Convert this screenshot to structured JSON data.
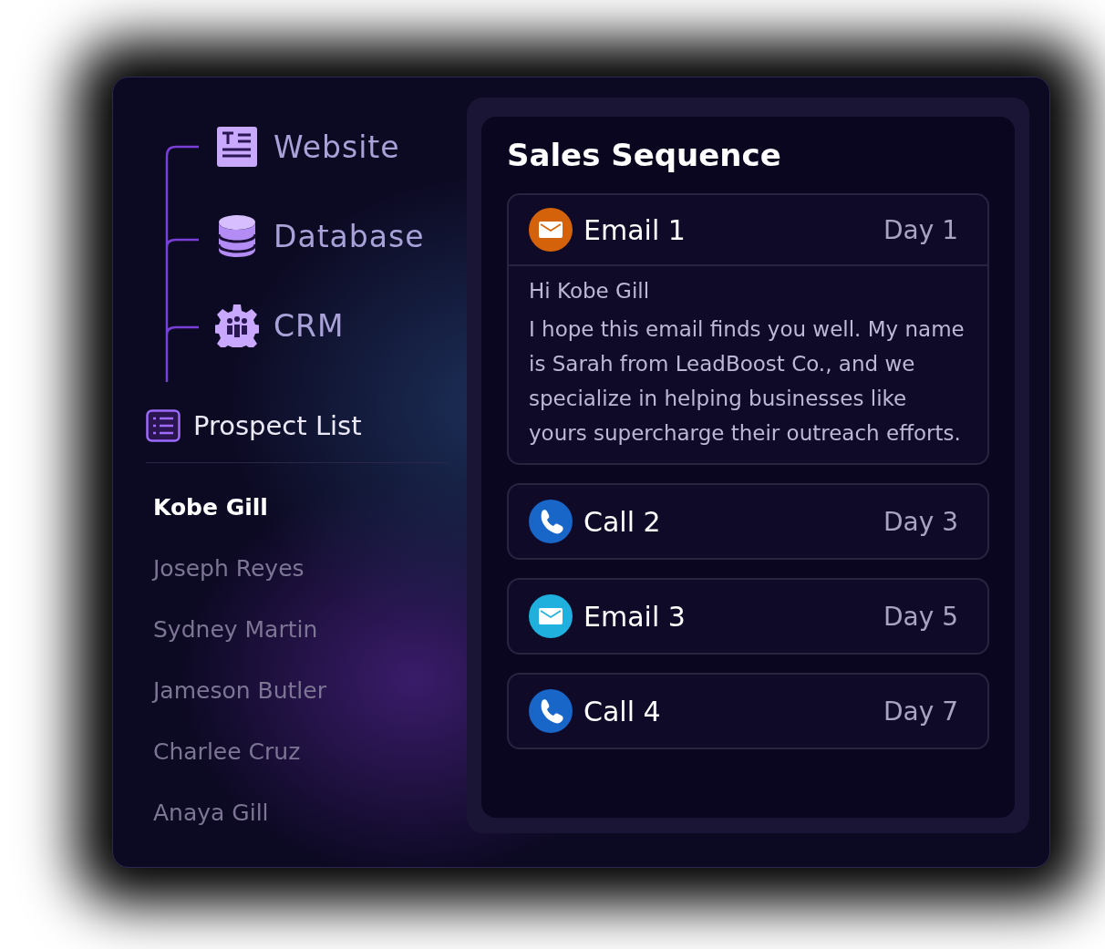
{
  "sources": [
    {
      "kind": "website",
      "label": "Website"
    },
    {
      "kind": "database",
      "label": "Database"
    },
    {
      "kind": "crm",
      "label": "CRM"
    }
  ],
  "prospect_list": {
    "title": "Prospect List",
    "prospects": [
      {
        "name": "Kobe Gill",
        "selected": true
      },
      {
        "name": "Joseph Reyes",
        "selected": false
      },
      {
        "name": "Sydney Martin",
        "selected": false
      },
      {
        "name": "Jameson Butler",
        "selected": false
      },
      {
        "name": "Charlee Cruz",
        "selected": false
      },
      {
        "name": "Anaya Gill",
        "selected": false
      }
    ]
  },
  "sales_sequence": {
    "title": "Sales Sequence",
    "steps": [
      {
        "kind": "email",
        "color": "#d4620a",
        "label": "Email 1",
        "day": "Day 1",
        "expanded": true,
        "greeting": "Hi Kobe Gill",
        "body": "I hope this email finds you well. My name is Sarah from LeadBoost Co., and we specialize in helping businesses like yours supercharge their outreach efforts."
      },
      {
        "kind": "call",
        "color": "#1766c8",
        "label": "Call 2",
        "day": "Day 3",
        "expanded": false
      },
      {
        "kind": "email",
        "color": "#1fb0de",
        "label": "Email 3",
        "day": "Day 5",
        "expanded": false
      },
      {
        "kind": "call",
        "color": "#1766c8",
        "label": "Call 4",
        "day": "Day 7",
        "expanded": false
      }
    ]
  }
}
